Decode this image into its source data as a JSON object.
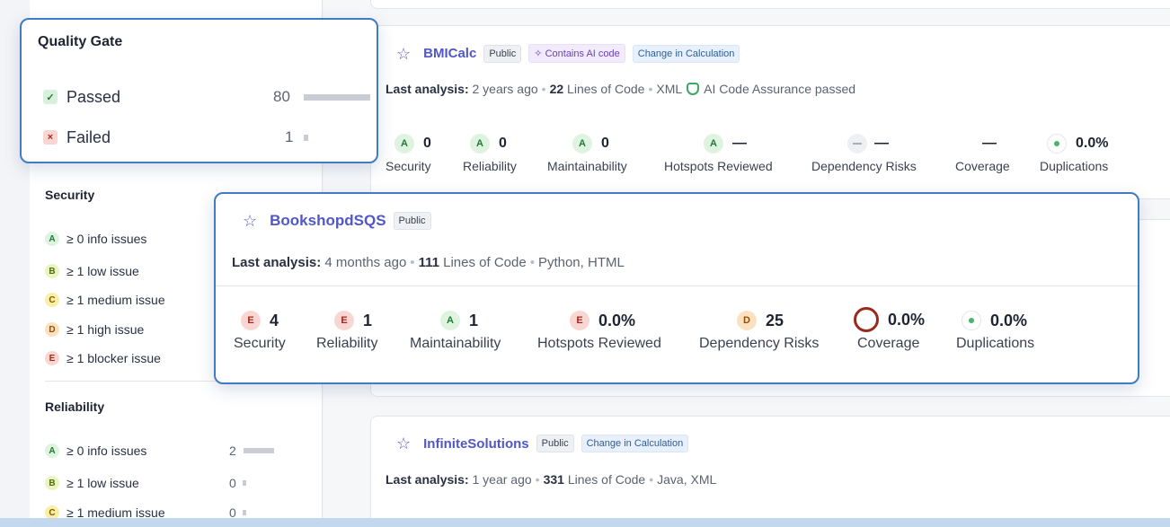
{
  "quality_gate": {
    "title": "Quality Gate",
    "options": [
      {
        "label": "Passed",
        "count": "80",
        "bar_fraction": 1.0
      },
      {
        "label": "Failed",
        "count": "1",
        "bar_fraction": 0.05
      }
    ]
  },
  "security": {
    "title": "Security",
    "filters": [
      {
        "rating": "A",
        "label": "≥ 0 info issues"
      },
      {
        "rating": "B",
        "label": "≥ 1 low issue"
      },
      {
        "rating": "C",
        "label": "≥ 1 medium issue"
      },
      {
        "rating": "D",
        "label": "≥ 1 high issue"
      },
      {
        "rating": "E",
        "label": "≥ 1 blocker issue"
      }
    ]
  },
  "reliability": {
    "title": "Reliability",
    "filters": [
      {
        "rating": "A",
        "label": "≥ 0 info issues",
        "count": "2"
      },
      {
        "rating": "B",
        "label": "≥ 1 low issue",
        "count": "0"
      },
      {
        "rating": "C",
        "label": "≥ 1 medium issue",
        "count": "0"
      }
    ]
  },
  "projects": {
    "bmicalc": {
      "name": "BMICalc",
      "tags": [
        "Public",
        "Contains AI code",
        "Change in Calculation"
      ],
      "meta_prefix": "Last analysis:",
      "meta_when": "2 years ago",
      "loc": "22",
      "loc_label": "Lines of Code",
      "languages": "XML",
      "ai_assurance": "AI Code Assurance passed",
      "metrics": [
        {
          "rating": "A",
          "value": "0",
          "label": "Security"
        },
        {
          "rating": "A",
          "value": "0",
          "label": "Reliability"
        },
        {
          "rating": "A",
          "value": "0",
          "label": "Maintainability"
        },
        {
          "rating": "A",
          "value": "—",
          "label": "Hotspots Reviewed"
        },
        {
          "rating": "",
          "value": "—",
          "label": "Dependency Risks"
        },
        {
          "rating": "",
          "value": "—",
          "label": "Coverage"
        },
        {
          "rating": "",
          "value": "0.0%",
          "label": "Duplications"
        }
      ]
    },
    "bookshop": {
      "name": "BookshopdSQS",
      "tag": "Public",
      "meta_prefix": "Last analysis:",
      "meta_when": "4 months ago",
      "loc": "111",
      "loc_label": "Lines of Code",
      "languages": "Python, HTML",
      "metrics": [
        {
          "rating": "E",
          "value": "4",
          "label": "Security"
        },
        {
          "rating": "E",
          "value": "1",
          "label": "Reliability"
        },
        {
          "rating": "A",
          "value": "1",
          "label": "Maintainability"
        },
        {
          "rating": "E",
          "value": "0.0%",
          "label": "Hotspots Reviewed"
        },
        {
          "rating": "D",
          "value": "25",
          "label": "Dependency Risks"
        },
        {
          "rating": "",
          "value": "0.0%",
          "label": "Coverage"
        },
        {
          "rating": "",
          "value": "0.0%",
          "label": "Duplications"
        }
      ]
    },
    "infinite": {
      "name": "InfiniteSolutions",
      "tags": [
        "Public",
        "Change in Calculation"
      ],
      "meta_prefix": "Last analysis:",
      "meta_when": "1 year ago",
      "loc": "331",
      "loc_label": "Lines of Code",
      "languages": "Java, XML"
    }
  }
}
